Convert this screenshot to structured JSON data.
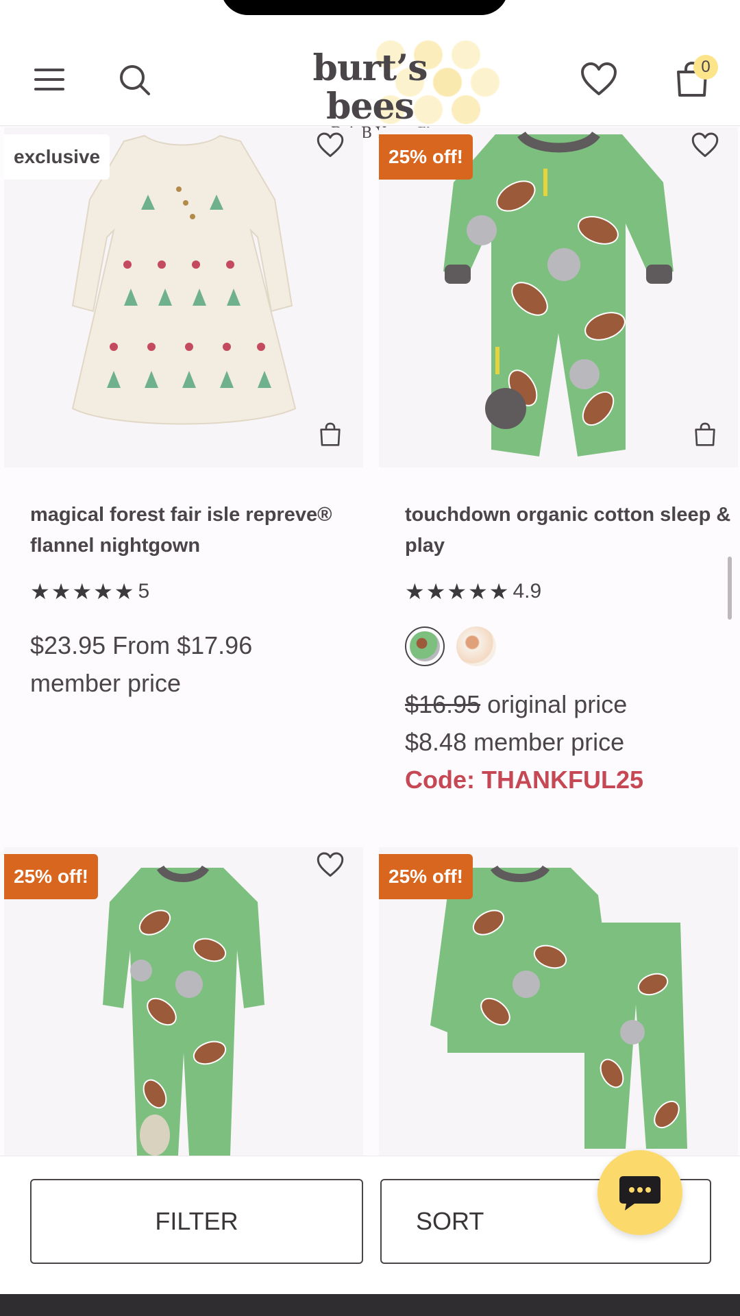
{
  "header": {
    "logo_main": "burt’s bees",
    "logo_sub": "···BABY···™",
    "cart_count": "0",
    "icons": [
      "menu-icon",
      "search-icon",
      "heart-icon",
      "shopping-bag-icon"
    ]
  },
  "products": [
    {
      "badge": "exclusive",
      "title": "magical forest fair isle repreve® flannel nightgown",
      "rating_value": "5",
      "stars": "★★★★★",
      "price_line1": "$23.95 From $17.96",
      "price_line2": "member price"
    },
    {
      "badge": "25% off!",
      "title": "touchdown organic cotton sleep & play",
      "rating_value": "4.9",
      "stars": "★★★★★",
      "original_price": "$16.95",
      "original_label": "original price",
      "member_price": "$8.48 member price",
      "code": "Code: THANKFUL25",
      "swatch_count": 2
    },
    {
      "badge": "25% off!"
    },
    {
      "badge": "25% off!"
    }
  ],
  "bottom": {
    "filter_label": "FILTER",
    "sort_label": "SORT"
  },
  "colors": {
    "badge_sale": "#d9661f",
    "promo_code": "#c64855",
    "chat_button": "#fcd96b"
  }
}
